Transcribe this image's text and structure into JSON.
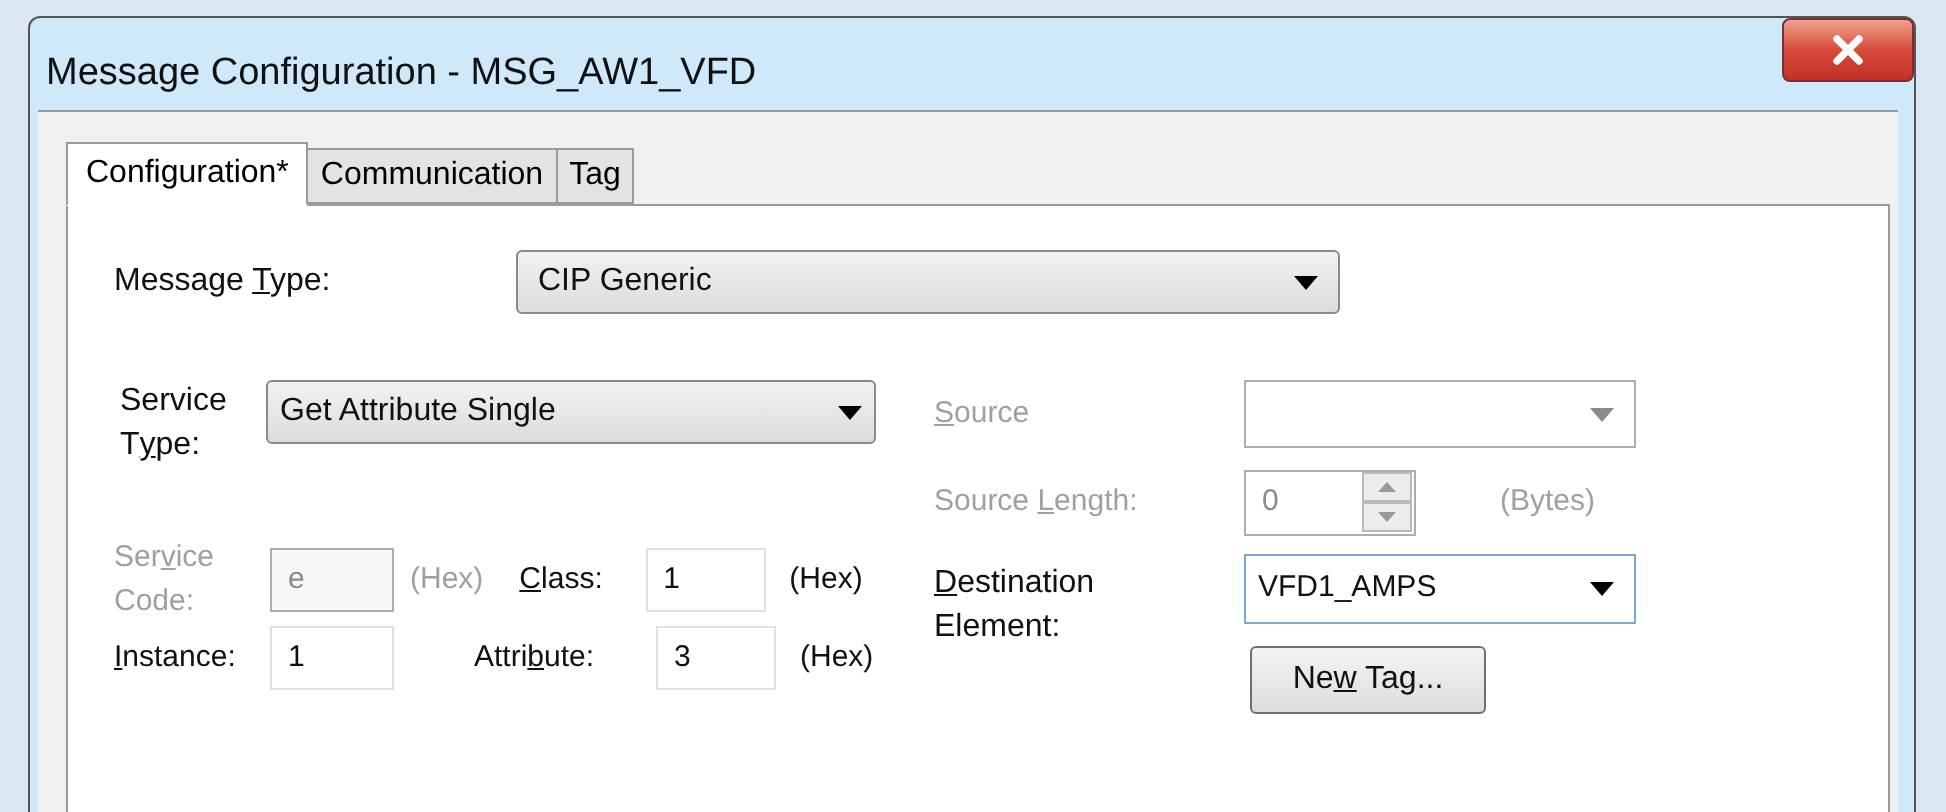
{
  "window": {
    "title": "Message Configuration - MSG_AW1_VFD"
  },
  "tabs": [
    {
      "label": "Configuration*",
      "selected": true
    },
    {
      "label": "Communication",
      "selected": false
    },
    {
      "label": "Tag",
      "selected": false
    }
  ],
  "message_type": {
    "label": [
      {
        "text": "Message ",
        "access_key": false
      },
      {
        "text": "T",
        "access_key": true
      },
      {
        "text": "ype:",
        "access_key": false
      }
    ],
    "value": "CIP Generic",
    "disabled": false
  },
  "service_type": {
    "label": [
      {
        "text": "Service T",
        "access_key": false
      },
      {
        "text": "y",
        "access_key": true
      },
      {
        "text": "pe:",
        "access_key": false
      }
    ],
    "value": "Get Attribute Single",
    "disabled": false
  },
  "service_code": {
    "label": [
      {
        "text": "Ser",
        "access_key": false
      },
      {
        "text": "v",
        "access_key": true
      },
      {
        "text": "ice Code:",
        "access_key": false
      }
    ],
    "value": "e",
    "unit": "(Hex)",
    "disabled": true
  },
  "class": {
    "label": [
      {
        "text": "C",
        "access_key": true
      },
      {
        "text": "lass:",
        "access_key": false
      }
    ],
    "value": "1",
    "unit": "(Hex)",
    "disabled": false
  },
  "instance": {
    "label": [
      {
        "text": "I",
        "access_key": true
      },
      {
        "text": "nstance:",
        "access_key": false
      }
    ],
    "value": "1",
    "disabled": false
  },
  "attribute": {
    "label": [
      {
        "text": "Attri",
        "access_key": false
      },
      {
        "text": "b",
        "access_key": true
      },
      {
        "text": "ute:",
        "access_key": false
      }
    ],
    "value": "3",
    "unit": "(Hex)",
    "disabled": false
  },
  "source": {
    "label": [
      {
        "text": "S",
        "access_key": true
      },
      {
        "text": "ource",
        "access_key": false
      }
    ],
    "disabled": true
  },
  "source_length": {
    "label": [
      {
        "text": "Source ",
        "access_key": false
      },
      {
        "text": "L",
        "access_key": true
      },
      {
        "text": "ength:",
        "access_key": false
      }
    ],
    "value": "0",
    "unit": "(Bytes)",
    "disabled": true
  },
  "destination_element": {
    "label": [
      {
        "text": "D",
        "access_key": true
      },
      {
        "text": "estination Element:",
        "access_key": false
      }
    ],
    "value": "VFD1_AMPS",
    "disabled": false,
    "focused": true
  },
  "new_tag_button": {
    "label": [
      {
        "text": "Ne",
        "access_key": false
      },
      {
        "text": "w",
        "access_key": true
      },
      {
        "text": " Tag...",
        "access_key": false
      }
    ],
    "disabled": false
  }
}
